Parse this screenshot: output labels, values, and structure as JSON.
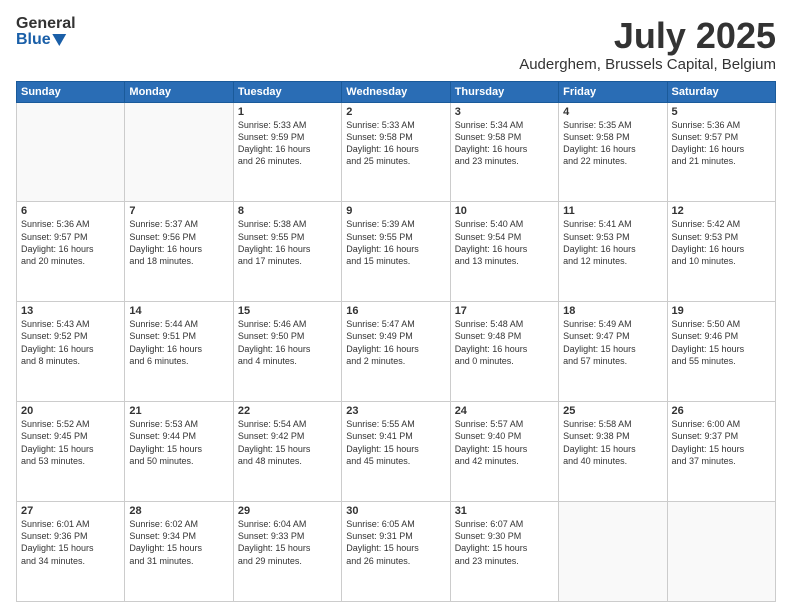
{
  "header": {
    "logo_line1": "General",
    "logo_line2": "Blue",
    "month": "July 2025",
    "location": "Auderghem, Brussels Capital, Belgium"
  },
  "weekdays": [
    "Sunday",
    "Monday",
    "Tuesday",
    "Wednesday",
    "Thursday",
    "Friday",
    "Saturday"
  ],
  "weeks": [
    [
      {
        "day": "",
        "info": ""
      },
      {
        "day": "",
        "info": ""
      },
      {
        "day": "1",
        "info": "Sunrise: 5:33 AM\nSunset: 9:59 PM\nDaylight: 16 hours\nand 26 minutes."
      },
      {
        "day": "2",
        "info": "Sunrise: 5:33 AM\nSunset: 9:58 PM\nDaylight: 16 hours\nand 25 minutes."
      },
      {
        "day": "3",
        "info": "Sunrise: 5:34 AM\nSunset: 9:58 PM\nDaylight: 16 hours\nand 23 minutes."
      },
      {
        "day": "4",
        "info": "Sunrise: 5:35 AM\nSunset: 9:58 PM\nDaylight: 16 hours\nand 22 minutes."
      },
      {
        "day": "5",
        "info": "Sunrise: 5:36 AM\nSunset: 9:57 PM\nDaylight: 16 hours\nand 21 minutes."
      }
    ],
    [
      {
        "day": "6",
        "info": "Sunrise: 5:36 AM\nSunset: 9:57 PM\nDaylight: 16 hours\nand 20 minutes."
      },
      {
        "day": "7",
        "info": "Sunrise: 5:37 AM\nSunset: 9:56 PM\nDaylight: 16 hours\nand 18 minutes."
      },
      {
        "day": "8",
        "info": "Sunrise: 5:38 AM\nSunset: 9:55 PM\nDaylight: 16 hours\nand 17 minutes."
      },
      {
        "day": "9",
        "info": "Sunrise: 5:39 AM\nSunset: 9:55 PM\nDaylight: 16 hours\nand 15 minutes."
      },
      {
        "day": "10",
        "info": "Sunrise: 5:40 AM\nSunset: 9:54 PM\nDaylight: 16 hours\nand 13 minutes."
      },
      {
        "day": "11",
        "info": "Sunrise: 5:41 AM\nSunset: 9:53 PM\nDaylight: 16 hours\nand 12 minutes."
      },
      {
        "day": "12",
        "info": "Sunrise: 5:42 AM\nSunset: 9:53 PM\nDaylight: 16 hours\nand 10 minutes."
      }
    ],
    [
      {
        "day": "13",
        "info": "Sunrise: 5:43 AM\nSunset: 9:52 PM\nDaylight: 16 hours\nand 8 minutes."
      },
      {
        "day": "14",
        "info": "Sunrise: 5:44 AM\nSunset: 9:51 PM\nDaylight: 16 hours\nand 6 minutes."
      },
      {
        "day": "15",
        "info": "Sunrise: 5:46 AM\nSunset: 9:50 PM\nDaylight: 16 hours\nand 4 minutes."
      },
      {
        "day": "16",
        "info": "Sunrise: 5:47 AM\nSunset: 9:49 PM\nDaylight: 16 hours\nand 2 minutes."
      },
      {
        "day": "17",
        "info": "Sunrise: 5:48 AM\nSunset: 9:48 PM\nDaylight: 16 hours\nand 0 minutes."
      },
      {
        "day": "18",
        "info": "Sunrise: 5:49 AM\nSunset: 9:47 PM\nDaylight: 15 hours\nand 57 minutes."
      },
      {
        "day": "19",
        "info": "Sunrise: 5:50 AM\nSunset: 9:46 PM\nDaylight: 15 hours\nand 55 minutes."
      }
    ],
    [
      {
        "day": "20",
        "info": "Sunrise: 5:52 AM\nSunset: 9:45 PM\nDaylight: 15 hours\nand 53 minutes."
      },
      {
        "day": "21",
        "info": "Sunrise: 5:53 AM\nSunset: 9:44 PM\nDaylight: 15 hours\nand 50 minutes."
      },
      {
        "day": "22",
        "info": "Sunrise: 5:54 AM\nSunset: 9:42 PM\nDaylight: 15 hours\nand 48 minutes."
      },
      {
        "day": "23",
        "info": "Sunrise: 5:55 AM\nSunset: 9:41 PM\nDaylight: 15 hours\nand 45 minutes."
      },
      {
        "day": "24",
        "info": "Sunrise: 5:57 AM\nSunset: 9:40 PM\nDaylight: 15 hours\nand 42 minutes."
      },
      {
        "day": "25",
        "info": "Sunrise: 5:58 AM\nSunset: 9:38 PM\nDaylight: 15 hours\nand 40 minutes."
      },
      {
        "day": "26",
        "info": "Sunrise: 6:00 AM\nSunset: 9:37 PM\nDaylight: 15 hours\nand 37 minutes."
      }
    ],
    [
      {
        "day": "27",
        "info": "Sunrise: 6:01 AM\nSunset: 9:36 PM\nDaylight: 15 hours\nand 34 minutes."
      },
      {
        "day": "28",
        "info": "Sunrise: 6:02 AM\nSunset: 9:34 PM\nDaylight: 15 hours\nand 31 minutes."
      },
      {
        "day": "29",
        "info": "Sunrise: 6:04 AM\nSunset: 9:33 PM\nDaylight: 15 hours\nand 29 minutes."
      },
      {
        "day": "30",
        "info": "Sunrise: 6:05 AM\nSunset: 9:31 PM\nDaylight: 15 hours\nand 26 minutes."
      },
      {
        "day": "31",
        "info": "Sunrise: 6:07 AM\nSunset: 9:30 PM\nDaylight: 15 hours\nand 23 minutes."
      },
      {
        "day": "",
        "info": ""
      },
      {
        "day": "",
        "info": ""
      }
    ]
  ]
}
